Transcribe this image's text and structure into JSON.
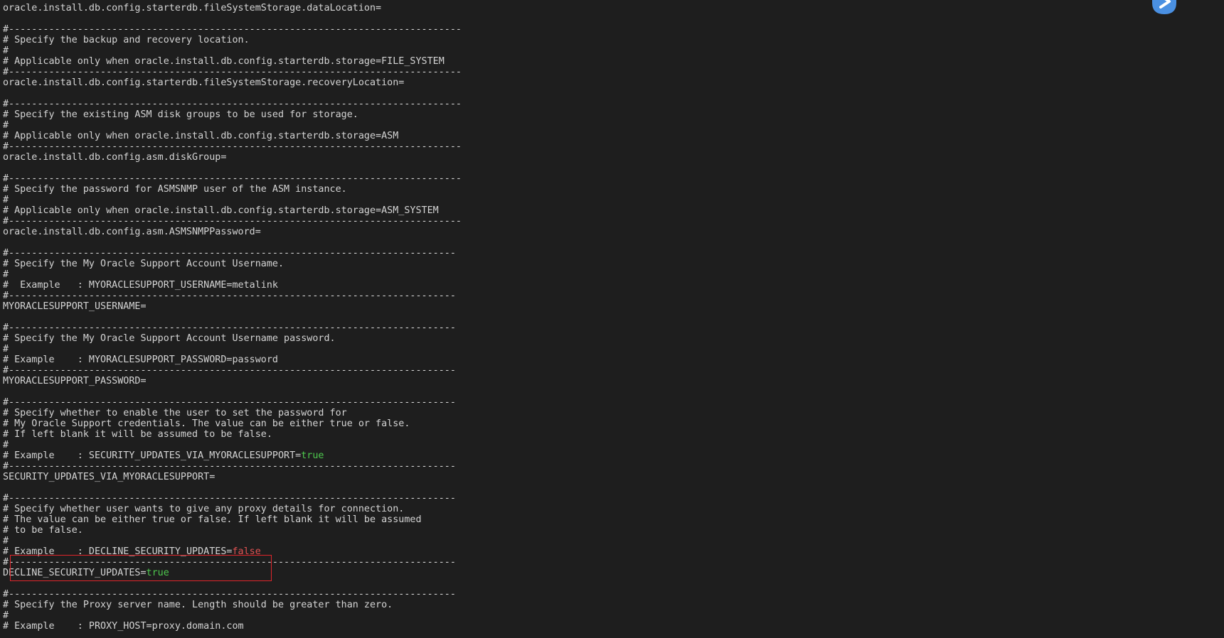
{
  "terminal": {
    "lines": [
      {
        "text": "oracle.install.db.config.starterdb.fileSystemStorage.dataLocation="
      },
      {
        "text": ""
      },
      {
        "text": "#-------------------------------------------------------------------------------"
      },
      {
        "text": "# Specify the backup and recovery location."
      },
      {
        "text": "#"
      },
      {
        "text": "# Applicable only when oracle.install.db.config.starterdb.storage=FILE_SYSTEM"
      },
      {
        "text": "#-------------------------------------------------------------------------------"
      },
      {
        "text": "oracle.install.db.config.starterdb.fileSystemStorage.recoveryLocation="
      },
      {
        "text": ""
      },
      {
        "text": "#-------------------------------------------------------------------------------"
      },
      {
        "text": "# Specify the existing ASM disk groups to be used for storage."
      },
      {
        "text": "#"
      },
      {
        "text": "# Applicable only when oracle.install.db.config.starterdb.storage=ASM"
      },
      {
        "text": "#-------------------------------------------------------------------------------"
      },
      {
        "text": "oracle.install.db.config.asm.diskGroup="
      },
      {
        "text": ""
      },
      {
        "text": "#-------------------------------------------------------------------------------"
      },
      {
        "text": "# Specify the password for ASMSNMP user of the ASM instance."
      },
      {
        "text": "#"
      },
      {
        "text": "# Applicable only when oracle.install.db.config.starterdb.storage=ASM_SYSTEM"
      },
      {
        "text": "#-------------------------------------------------------------------------------"
      },
      {
        "text": "oracle.install.db.config.asm.ASMSNMPPassword="
      },
      {
        "text": ""
      },
      {
        "text": "#------------------------------------------------------------------------------"
      },
      {
        "text": "# Specify the My Oracle Support Account Username."
      },
      {
        "text": "#"
      },
      {
        "text": "#  Example   : MYORACLESUPPORT_USERNAME=metalink"
      },
      {
        "text": "#------------------------------------------------------------------------------"
      },
      {
        "text": "MYORACLESUPPORT_USERNAME="
      },
      {
        "text": ""
      },
      {
        "text": "#------------------------------------------------------------------------------"
      },
      {
        "text": "# Specify the My Oracle Support Account Username password."
      },
      {
        "text": "#"
      },
      {
        "text": "# Example    : MYORACLESUPPORT_PASSWORD=password"
      },
      {
        "text": "#------------------------------------------------------------------------------"
      },
      {
        "text": "MYORACLESUPPORT_PASSWORD="
      },
      {
        "text": ""
      },
      {
        "text": "#------------------------------------------------------------------------------"
      },
      {
        "text": "# Specify whether to enable the user to set the password for"
      },
      {
        "text": "# My Oracle Support credentials. The value can be either true or false."
      },
      {
        "text": "# If left blank it will be assumed to be false."
      },
      {
        "text": "#"
      },
      {
        "text": "# Example    : SECURITY_UPDATES_VIA_MYORACLESUPPORT=",
        "value": "true",
        "value_color": "green"
      },
      {
        "text": "#------------------------------------------------------------------------------"
      },
      {
        "text": "SECURITY_UPDATES_VIA_MYORACLESUPPORT="
      },
      {
        "text": ""
      },
      {
        "text": "#------------------------------------------------------------------------------"
      },
      {
        "text": "# Specify whether user wants to give any proxy details for connection."
      },
      {
        "text": "# The value can be either true or false. If left blank it will be assumed"
      },
      {
        "text": "# to be false."
      },
      {
        "text": "#"
      },
      {
        "text": "# Example    : DECLINE_SECURITY_UPDATES=",
        "value": "false",
        "value_color": "red"
      },
      {
        "text": "#------------------------------------------------------------------------------"
      },
      {
        "text": "DECLINE_SECURITY_UPDATES=",
        "value": "true",
        "value_color": "green"
      },
      {
        "text": ""
      },
      {
        "text": "#------------------------------------------------------------------------------"
      },
      {
        "text": "# Specify the Proxy server name. Length should be greater than zero."
      },
      {
        "text": "#"
      },
      {
        "text": "# Example    : PROXY_HOST=proxy.domain.com"
      }
    ]
  },
  "colors": {
    "background": "#1e1e1e",
    "text": "#d4d4d4",
    "green": "#4ec94e",
    "red": "#e05252",
    "highlight_border": "#e0262b",
    "icon": "#4a90e2"
  },
  "icons": {
    "floating": "floating-assistant-icon"
  }
}
